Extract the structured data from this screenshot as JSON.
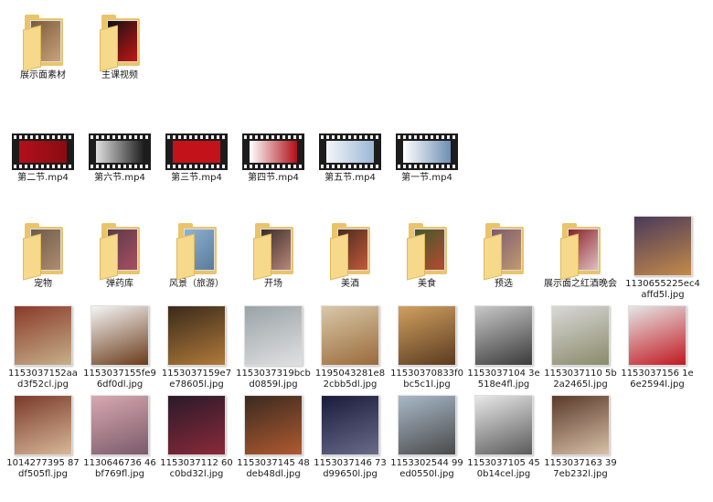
{
  "top_folders": [
    {
      "label": "展示面素材",
      "colors": [
        "#7a5a3a",
        "#c9a27a"
      ]
    },
    {
      "label": "主课视频",
      "colors": [
        "#111111",
        "#c41616"
      ]
    }
  ],
  "videos": [
    {
      "label": "第二节.mp4",
      "colors": [
        "#b2101a",
        "#8a0c14"
      ]
    },
    {
      "label": "第六节.mp4",
      "colors": [
        "#e0e0e0",
        "#202020"
      ]
    },
    {
      "label": "第三节.mp4",
      "colors": [
        "#c4121b",
        "#c4121b"
      ]
    },
    {
      "label": "第四节.mp4",
      "colors": [
        "#ffffff",
        "#b10f18"
      ]
    },
    {
      "label": "第五节.mp4",
      "colors": [
        "#f4f6f9",
        "#9bb7d6"
      ]
    },
    {
      "label": "第一节.mp4",
      "colors": [
        "#ffffff",
        "#6e8fb5"
      ]
    }
  ],
  "mid_folders": [
    {
      "label": "宠物",
      "colors": [
        "#6b5a4b",
        "#b08c6d"
      ]
    },
    {
      "label": "弹药库",
      "colors": [
        "#5c3a48",
        "#a64f62"
      ]
    },
    {
      "label": "风景（旅游）",
      "colors": [
        "#8db3d6",
        "#5c7a98"
      ]
    },
    {
      "label": "开场",
      "colors": [
        "#3a2c2a",
        "#b9877a"
      ]
    },
    {
      "label": "美酒",
      "colors": [
        "#4a2a20",
        "#c25a3a"
      ]
    },
    {
      "label": "美食",
      "colors": [
        "#3e5a2e",
        "#b74a2f"
      ]
    },
    {
      "label": "预选",
      "colors": [
        "#7a5a70",
        "#c29a70"
      ]
    },
    {
      "label": "展示面之红酒晚会",
      "colors": [
        "#8a1f2a",
        "#ddc0c0"
      ]
    }
  ],
  "images": [
    {
      "label": "1130655225ec4affd5l.jpg",
      "colors": [
        "#4a3a5a",
        "#c48a4a"
      ]
    },
    {
      "label": "1153037152aad3f52cl.jpg",
      "colors": [
        "#8a3a2a",
        "#c6b08a"
      ]
    },
    {
      "label": "1153037155fe96df0dl.jpg",
      "colors": [
        "#f5f5f5",
        "#6a3a1a"
      ]
    },
    {
      "label": "1153037159e7e78605l.jpg",
      "colors": [
        "#3a2a1a",
        "#b07a3a"
      ]
    },
    {
      "label": "1153037319bcbd0859l.jpg",
      "colors": [
        "#9aa3a8",
        "#e0e0e0"
      ]
    },
    {
      "label": "1195043281e82cbb5dl.jpg",
      "colors": [
        "#d8c8a8",
        "#9a6a3a"
      ]
    },
    {
      "label": "11530370833f0bc5c1l.jpg",
      "colors": [
        "#d0a060",
        "#5a3a20"
      ]
    },
    {
      "label": "1153037104 3e518e4fl.jpg",
      "colors": [
        "#c8c8c8",
        "#3a3a3a"
      ]
    },
    {
      "label": "1153037110 5b2a2465l.jpg",
      "colors": [
        "#d8d8d8",
        "#8a8a6a"
      ]
    },
    {
      "label": "1153037156 1e6e2594l.jpg",
      "colors": [
        "#e6e6e6",
        "#c01820"
      ]
    },
    {
      "label": "1014277395 87df505fl.jpg",
      "colors": [
        "#7a3a2a",
        "#d8b898"
      ]
    },
    {
      "label": "1130646736 46bf769fl.jpg",
      "colors": [
        "#d8a8b0",
        "#7a5a6a"
      ]
    },
    {
      "label": "1153037112 60c0bd32l.jpg",
      "colors": [
        "#2a1a2a",
        "#8a2a3a"
      ]
    },
    {
      "label": "1153037145 48deb48dl.jpg",
      "colors": [
        "#3a2a20",
        "#b05a30"
      ]
    },
    {
      "label": "1153037146 73d99650l.jpg",
      "colors": [
        "#1a1a3a",
        "#6a6a8a"
      ]
    },
    {
      "label": "1153302544 99ed0550l.jpg",
      "colors": [
        "#a8b8c8",
        "#4a4a4a"
      ]
    },
    {
      "label": "1153037105 450b14cel.jpg",
      "colors": [
        "#e8e8e8",
        "#5a5a5a"
      ]
    },
    {
      "label": "1153037163 397eb232l.jpg",
      "colors": [
        "#5a3a2a",
        "#d8c0a8"
      ]
    }
  ]
}
